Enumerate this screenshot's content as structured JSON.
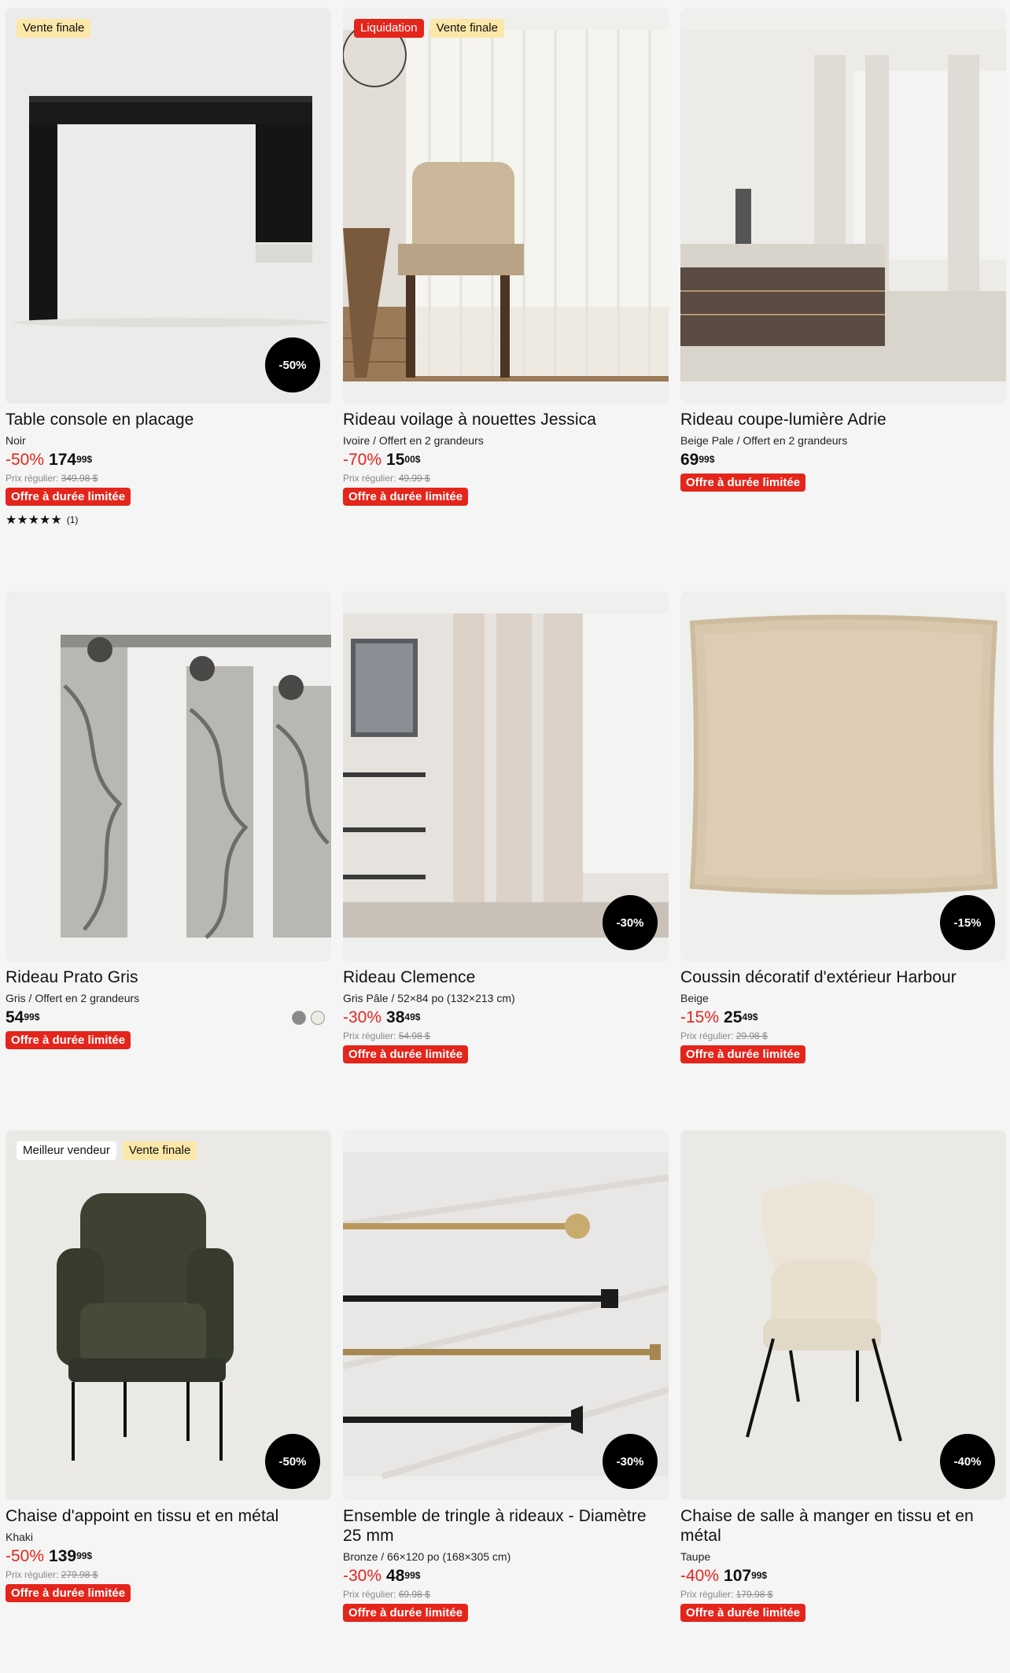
{
  "products": [
    {
      "badges": [
        {
          "label": "Vente finale",
          "style": "yellow"
        }
      ],
      "discount_badge": "-50%",
      "title": "Table console en placage",
      "variant": "Noir",
      "pct": "-50%",
      "price": "174",
      "cents": "99$",
      "regular_label": "Prix régulier:",
      "regular_price": "349.98 $",
      "offer": "Offre à durée limitée",
      "stars": "★★★★★",
      "reviews": "(1)"
    },
    {
      "badges": [
        {
          "label": "Liquidation",
          "style": "red"
        },
        {
          "label": "Vente finale",
          "style": "yellow"
        }
      ],
      "discount_badge": "",
      "title": "Rideau voilage à nouettes Jessica",
      "variant": "Ivoire / Offert en 2 grandeurs",
      "pct": "-70%",
      "price": "15",
      "cents": "00$",
      "regular_label": "Prix régulier:",
      "regular_price": "49.99 $",
      "offer": "Offre à durée limitée"
    },
    {
      "badges": [],
      "discount_badge": "",
      "title": "Rideau coupe-lumière Adrie",
      "variant": "Beige Pale / Offert en 2 grandeurs",
      "pct": "",
      "price": "69",
      "cents": "99$",
      "offer": "Offre à durée limitée"
    },
    {
      "badges": [],
      "discount_badge": "",
      "title": "Rideau Prato Gris",
      "variant": "Gris / Offert en 2 grandeurs",
      "pct": "",
      "price": "54",
      "cents": "99$",
      "offer": "Offre à durée limitée",
      "swatch_colors": [
        "#8a8a8a",
        "#ecebe2"
      ]
    },
    {
      "badges": [],
      "discount_badge": "-30%",
      "title": "Rideau Clemence",
      "variant": "Gris Pâle / 52×84 po (132×213 cm)",
      "pct": "-30%",
      "price": "38",
      "cents": "49$",
      "regular_label": "Prix régulier:",
      "regular_price": "54.98 $",
      "offer": "Offre à durée limitée"
    },
    {
      "badges": [],
      "discount_badge": "-15%",
      "title": "Coussin décoratif d'extérieur Harbour",
      "variant": "Beige",
      "pct": "-15%",
      "price": "25",
      "cents": "49$",
      "regular_label": "Prix régulier:",
      "regular_price": "29.98 $",
      "offer": "Offre à durée limitée"
    },
    {
      "badges": [
        {
          "label": "Meilleur vendeur",
          "style": "white"
        },
        {
          "label": "Vente finale",
          "style": "yellow"
        }
      ],
      "discount_badge": "-50%",
      "title": "Chaise d'appoint en tissu et en métal",
      "variant": "Khaki",
      "pct": "-50%",
      "price": "139",
      "cents": "99$",
      "regular_label": "Prix régulier:",
      "regular_price": "279.98 $",
      "offer": "Offre à durée limitée"
    },
    {
      "badges": [],
      "discount_badge": "-30%",
      "title": "Ensemble de tringle à rideaux - Diamètre 25 mm",
      "variant": "Bronze / 66×120 po (168×305 cm)",
      "pct": "-30%",
      "price": "48",
      "cents": "99$",
      "regular_label": "Prix régulier:",
      "regular_price": "69.98 $",
      "offer": "Offre à durée limitée"
    },
    {
      "badges": [],
      "discount_badge": "-40%",
      "title": "Chaise de salle à manger en tissu et en métal",
      "variant": "Taupe",
      "pct": "-40%",
      "price": "107",
      "cents": "99$",
      "regular_label": "Prix régulier:",
      "regular_price": "179.98 $",
      "offer": "Offre à durée limitée"
    }
  ],
  "colors": {
    "accent_red": "#e4251b",
    "badge_yellow": "#fbe7a8",
    "background": "#f5f5f5"
  }
}
